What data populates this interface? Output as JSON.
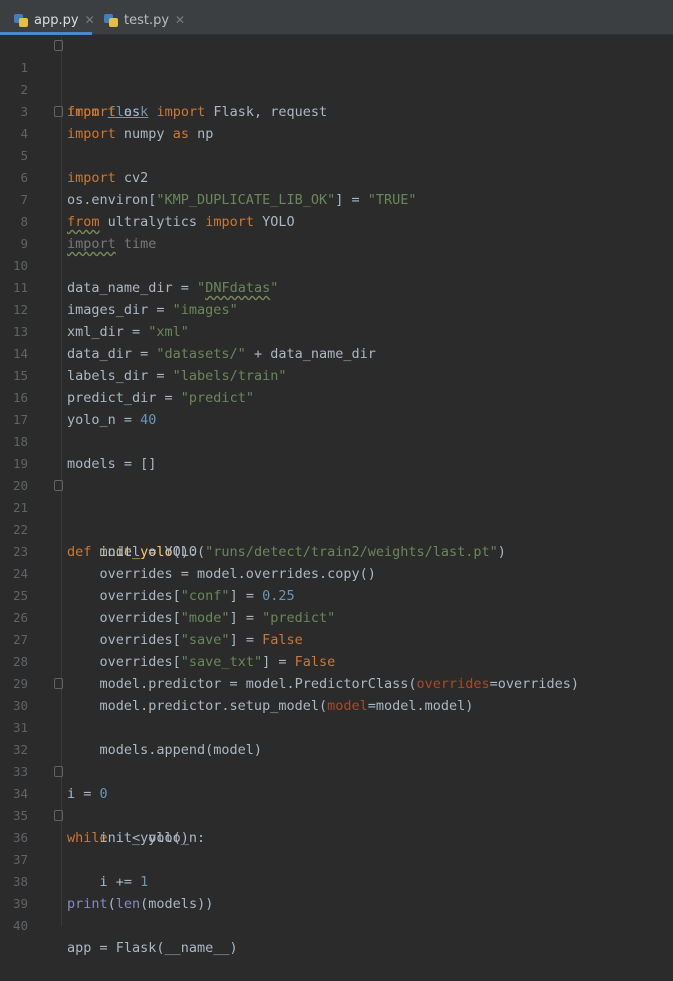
{
  "tabs": [
    {
      "label": "app.py",
      "close": "✕",
      "active": true
    },
    {
      "label": "test.py",
      "close": "✕",
      "active": false
    }
  ],
  "code": {
    "line_numbers": [
      "1",
      "2",
      "3",
      "4",
      "5",
      "6",
      "7",
      "8",
      "9",
      "10",
      "11",
      "12",
      "13",
      "14",
      "15",
      "16",
      "17",
      "18",
      "19",
      "20",
      "21",
      "22",
      "23",
      "24",
      "25",
      "26",
      "27",
      "28",
      "29",
      "30",
      "31",
      "32",
      "33",
      "34",
      "35",
      "36",
      "37",
      "38",
      "39",
      "40"
    ],
    "l1": [
      "from",
      " ",
      "flask",
      " ",
      "import",
      " Flask, request"
    ],
    "l2": [
      "import",
      " os"
    ],
    "l3": [
      "import",
      " numpy ",
      "as",
      " np"
    ],
    "l4": [
      "import",
      " cv2"
    ],
    "l6": [
      "os.environ[",
      "\"KMP_DUPLICATE_LIB_OK\"",
      "] = ",
      "\"TRUE\""
    ],
    "l7": [
      "from",
      " ultralytics ",
      "import",
      " YOLO"
    ],
    "l8": [
      "import",
      " time"
    ],
    "l10": [
      "data_name_dir = ",
      "\"",
      "DNFdatas",
      "\""
    ],
    "l11": [
      "images_dir = ",
      "\"images\""
    ],
    "l12": [
      "xml_dir = ",
      "\"xml\""
    ],
    "l13": [
      "data_dir = ",
      "\"datasets/\"",
      " + data_name_dir"
    ],
    "l14": [
      "labels_dir = ",
      "\"labels/train\""
    ],
    "l15": [
      "predict_dir = ",
      "\"predict\""
    ],
    "l16": [
      "yolo_n = ",
      "40"
    ],
    "l18": [
      "models = []"
    ],
    "l21": [
      "def",
      " ",
      "init_yolo",
      "():"
    ],
    "l22": [
      "    model = YOLO(",
      "\"runs/detect/train2/weights/last.pt\"",
      ")"
    ],
    "l23": [
      "    overrides = model.overrides.copy()"
    ],
    "l24": [
      "    overrides[",
      "\"conf\"",
      "] = ",
      "0.25"
    ],
    "l25": [
      "    overrides[",
      "\"mode\"",
      "] = ",
      "\"predict\""
    ],
    "l26": [
      "    overrides[",
      "\"save\"",
      "] = ",
      "False"
    ],
    "l27": [
      "    overrides[",
      "\"save_txt\"",
      "] = ",
      "False"
    ],
    "l28": [
      "    model.predictor = model.PredictorClass(",
      "overrides",
      "=overrides)"
    ],
    "l29": [
      "    model.predictor.setup_model(",
      "model",
      "=model.model)"
    ],
    "l30": [
      "    models.append(model)"
    ],
    "l33": [
      "i = ",
      "0"
    ],
    "l34": [
      "while",
      " i < yolo_n:"
    ],
    "l35": [
      "    init_yolo()"
    ],
    "l36": [
      "    i += ",
      "1"
    ],
    "l38": [
      "print",
      "(",
      "len",
      "(models))"
    ],
    "l40": [
      "app = Flask(__name__)"
    ]
  },
  "colors": {
    "background": "#2b2b2b",
    "keyword": "#cc7832",
    "string": "#6a8759",
    "number": "#6897bb",
    "function": "#ffc66d",
    "builtin": "#8888c6",
    "param": "#aa4926"
  }
}
